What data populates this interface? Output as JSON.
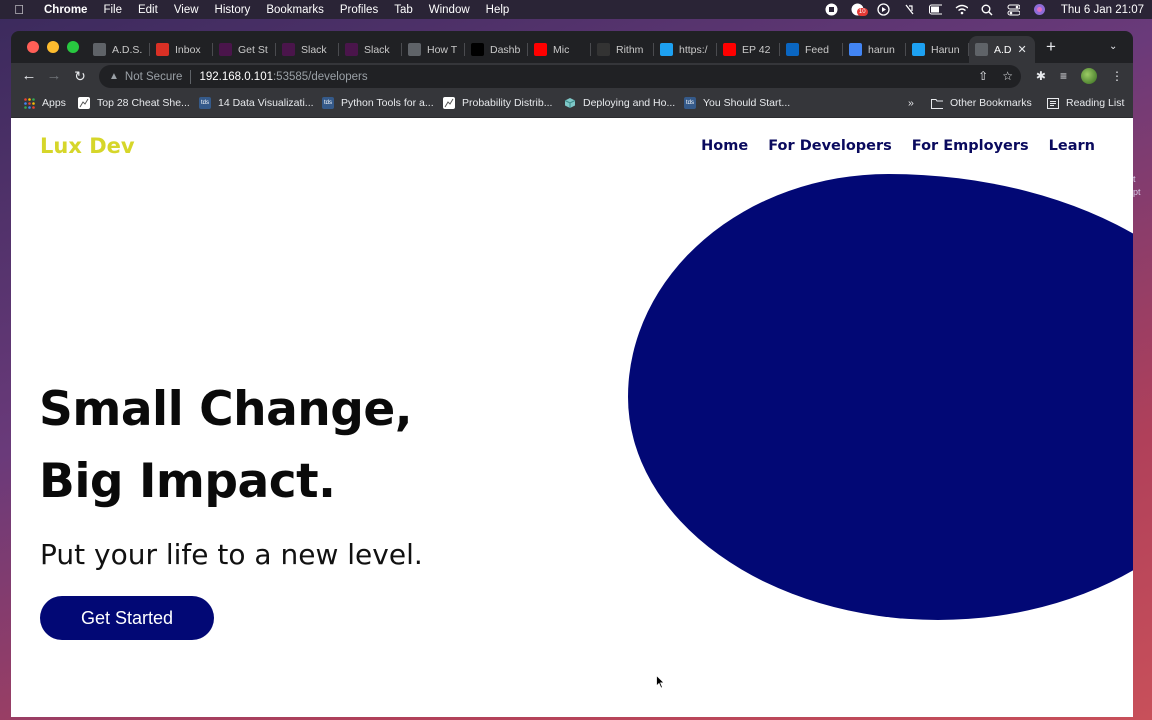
{
  "menubar": {
    "app": "Chrome",
    "items": [
      "File",
      "Edit",
      "View",
      "History",
      "Bookmarks",
      "Profiles",
      "Tab",
      "Window",
      "Help"
    ],
    "notif_badge": "10",
    "clock": "Thu 6 Jan  21:07"
  },
  "tabs": [
    {
      "label": "A.D.S.",
      "icon": "doc-icon",
      "color": "#5f6368"
    },
    {
      "label": "Inbox",
      "icon": "gmail-icon",
      "color": "#d93025"
    },
    {
      "label": "Get St",
      "icon": "slack-icon",
      "color": "#4a154b"
    },
    {
      "label": "Slack",
      "icon": "slack-icon",
      "color": "#4a154b"
    },
    {
      "label": "Slack",
      "icon": "slack-icon",
      "color": "#4a154b"
    },
    {
      "label": "How T",
      "icon": "notion-icon",
      "color": "#5f6368"
    },
    {
      "label": "Dashb",
      "icon": "dev-icon",
      "color": "#000000"
    },
    {
      "label": "Mic",
      "icon": "youtube-icon",
      "color": "#ff0000"
    },
    {
      "label": "Rithm",
      "icon": "rithm-icon",
      "color": "#333333"
    },
    {
      "label": "https:/",
      "icon": "twitter-icon",
      "color": "#1da1f2"
    },
    {
      "label": "EP 42",
      "icon": "youtube-icon",
      "color": "#ff0000"
    },
    {
      "label": "Feed",
      "icon": "linkedin-icon",
      "color": "#0a66c2"
    },
    {
      "label": "harun",
      "icon": "google-icon",
      "color": "#4285f4"
    },
    {
      "label": "Harun",
      "icon": "twitter-icon",
      "color": "#1da1f2"
    },
    {
      "label": "A.D",
      "icon": "doc-icon",
      "color": "#5f6368",
      "active": true
    }
  ],
  "address": {
    "security": "Not Secure",
    "host": "192.168.0.101",
    "path": ":53585/developers"
  },
  "bookmarks": [
    {
      "label": "Apps",
      "icon": "apps-grid-icon"
    },
    {
      "label": "Top 28 Cheat She...",
      "icon": "chart-icon"
    },
    {
      "label": "14 Data Visualizati...",
      "icon": "tds-icon"
    },
    {
      "label": "Python Tools for a...",
      "icon": "tds-icon"
    },
    {
      "label": "Probability Distrib...",
      "icon": "chart-icon"
    },
    {
      "label": "Deploying and Ho...",
      "icon": "cube-icon"
    },
    {
      "label": "You Should Start...",
      "icon": "tds-icon"
    }
  ],
  "bookmarks_overflow": "»",
  "other_bookmarks": "Other Bookmarks",
  "reading_list": "Reading List",
  "site": {
    "logo": "Lux Dev",
    "nav": [
      "Home",
      "For Developers",
      "For Employers",
      "Learn"
    ],
    "headline_line1": "Small Change,",
    "headline_line2": "Big Impact.",
    "subline": "Put your life to a new level.",
    "cta": "Get Started",
    "colors": {
      "logo": "#d6d62a",
      "primary": "#020875"
    }
  },
  "desktop_side_text": [
    "t",
    "pt"
  ]
}
